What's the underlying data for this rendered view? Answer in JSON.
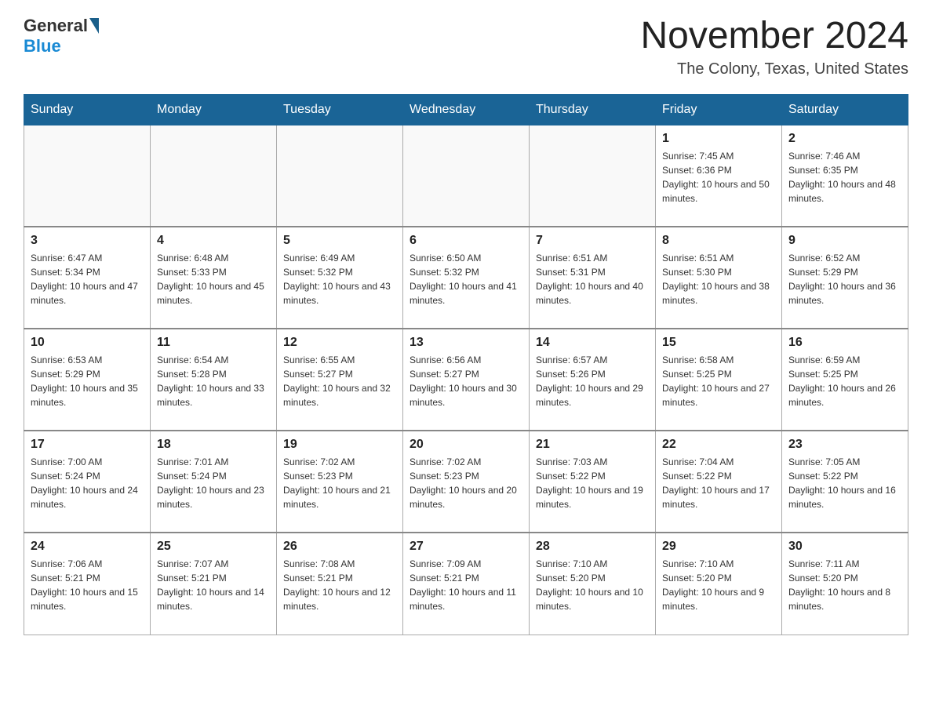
{
  "header": {
    "logo_general": "General",
    "logo_blue": "Blue",
    "month_title": "November 2024",
    "subtitle": "The Colony, Texas, United States"
  },
  "days_of_week": [
    "Sunday",
    "Monday",
    "Tuesday",
    "Wednesday",
    "Thursday",
    "Friday",
    "Saturday"
  ],
  "weeks": [
    [
      {
        "day": "",
        "info": ""
      },
      {
        "day": "",
        "info": ""
      },
      {
        "day": "",
        "info": ""
      },
      {
        "day": "",
        "info": ""
      },
      {
        "day": "",
        "info": ""
      },
      {
        "day": "1",
        "info": "Sunrise: 7:45 AM\nSunset: 6:36 PM\nDaylight: 10 hours and 50 minutes."
      },
      {
        "day": "2",
        "info": "Sunrise: 7:46 AM\nSunset: 6:35 PM\nDaylight: 10 hours and 48 minutes."
      }
    ],
    [
      {
        "day": "3",
        "info": "Sunrise: 6:47 AM\nSunset: 5:34 PM\nDaylight: 10 hours and 47 minutes."
      },
      {
        "day": "4",
        "info": "Sunrise: 6:48 AM\nSunset: 5:33 PM\nDaylight: 10 hours and 45 minutes."
      },
      {
        "day": "5",
        "info": "Sunrise: 6:49 AM\nSunset: 5:32 PM\nDaylight: 10 hours and 43 minutes."
      },
      {
        "day": "6",
        "info": "Sunrise: 6:50 AM\nSunset: 5:32 PM\nDaylight: 10 hours and 41 minutes."
      },
      {
        "day": "7",
        "info": "Sunrise: 6:51 AM\nSunset: 5:31 PM\nDaylight: 10 hours and 40 minutes."
      },
      {
        "day": "8",
        "info": "Sunrise: 6:51 AM\nSunset: 5:30 PM\nDaylight: 10 hours and 38 minutes."
      },
      {
        "day": "9",
        "info": "Sunrise: 6:52 AM\nSunset: 5:29 PM\nDaylight: 10 hours and 36 minutes."
      }
    ],
    [
      {
        "day": "10",
        "info": "Sunrise: 6:53 AM\nSunset: 5:29 PM\nDaylight: 10 hours and 35 minutes."
      },
      {
        "day": "11",
        "info": "Sunrise: 6:54 AM\nSunset: 5:28 PM\nDaylight: 10 hours and 33 minutes."
      },
      {
        "day": "12",
        "info": "Sunrise: 6:55 AM\nSunset: 5:27 PM\nDaylight: 10 hours and 32 minutes."
      },
      {
        "day": "13",
        "info": "Sunrise: 6:56 AM\nSunset: 5:27 PM\nDaylight: 10 hours and 30 minutes."
      },
      {
        "day": "14",
        "info": "Sunrise: 6:57 AM\nSunset: 5:26 PM\nDaylight: 10 hours and 29 minutes."
      },
      {
        "day": "15",
        "info": "Sunrise: 6:58 AM\nSunset: 5:25 PM\nDaylight: 10 hours and 27 minutes."
      },
      {
        "day": "16",
        "info": "Sunrise: 6:59 AM\nSunset: 5:25 PM\nDaylight: 10 hours and 26 minutes."
      }
    ],
    [
      {
        "day": "17",
        "info": "Sunrise: 7:00 AM\nSunset: 5:24 PM\nDaylight: 10 hours and 24 minutes."
      },
      {
        "day": "18",
        "info": "Sunrise: 7:01 AM\nSunset: 5:24 PM\nDaylight: 10 hours and 23 minutes."
      },
      {
        "day": "19",
        "info": "Sunrise: 7:02 AM\nSunset: 5:23 PM\nDaylight: 10 hours and 21 minutes."
      },
      {
        "day": "20",
        "info": "Sunrise: 7:02 AM\nSunset: 5:23 PM\nDaylight: 10 hours and 20 minutes."
      },
      {
        "day": "21",
        "info": "Sunrise: 7:03 AM\nSunset: 5:22 PM\nDaylight: 10 hours and 19 minutes."
      },
      {
        "day": "22",
        "info": "Sunrise: 7:04 AM\nSunset: 5:22 PM\nDaylight: 10 hours and 17 minutes."
      },
      {
        "day": "23",
        "info": "Sunrise: 7:05 AM\nSunset: 5:22 PM\nDaylight: 10 hours and 16 minutes."
      }
    ],
    [
      {
        "day": "24",
        "info": "Sunrise: 7:06 AM\nSunset: 5:21 PM\nDaylight: 10 hours and 15 minutes."
      },
      {
        "day": "25",
        "info": "Sunrise: 7:07 AM\nSunset: 5:21 PM\nDaylight: 10 hours and 14 minutes."
      },
      {
        "day": "26",
        "info": "Sunrise: 7:08 AM\nSunset: 5:21 PM\nDaylight: 10 hours and 12 minutes."
      },
      {
        "day": "27",
        "info": "Sunrise: 7:09 AM\nSunset: 5:21 PM\nDaylight: 10 hours and 11 minutes."
      },
      {
        "day": "28",
        "info": "Sunrise: 7:10 AM\nSunset: 5:20 PM\nDaylight: 10 hours and 10 minutes."
      },
      {
        "day": "29",
        "info": "Sunrise: 7:10 AM\nSunset: 5:20 PM\nDaylight: 10 hours and 9 minutes."
      },
      {
        "day": "30",
        "info": "Sunrise: 7:11 AM\nSunset: 5:20 PM\nDaylight: 10 hours and 8 minutes."
      }
    ]
  ]
}
